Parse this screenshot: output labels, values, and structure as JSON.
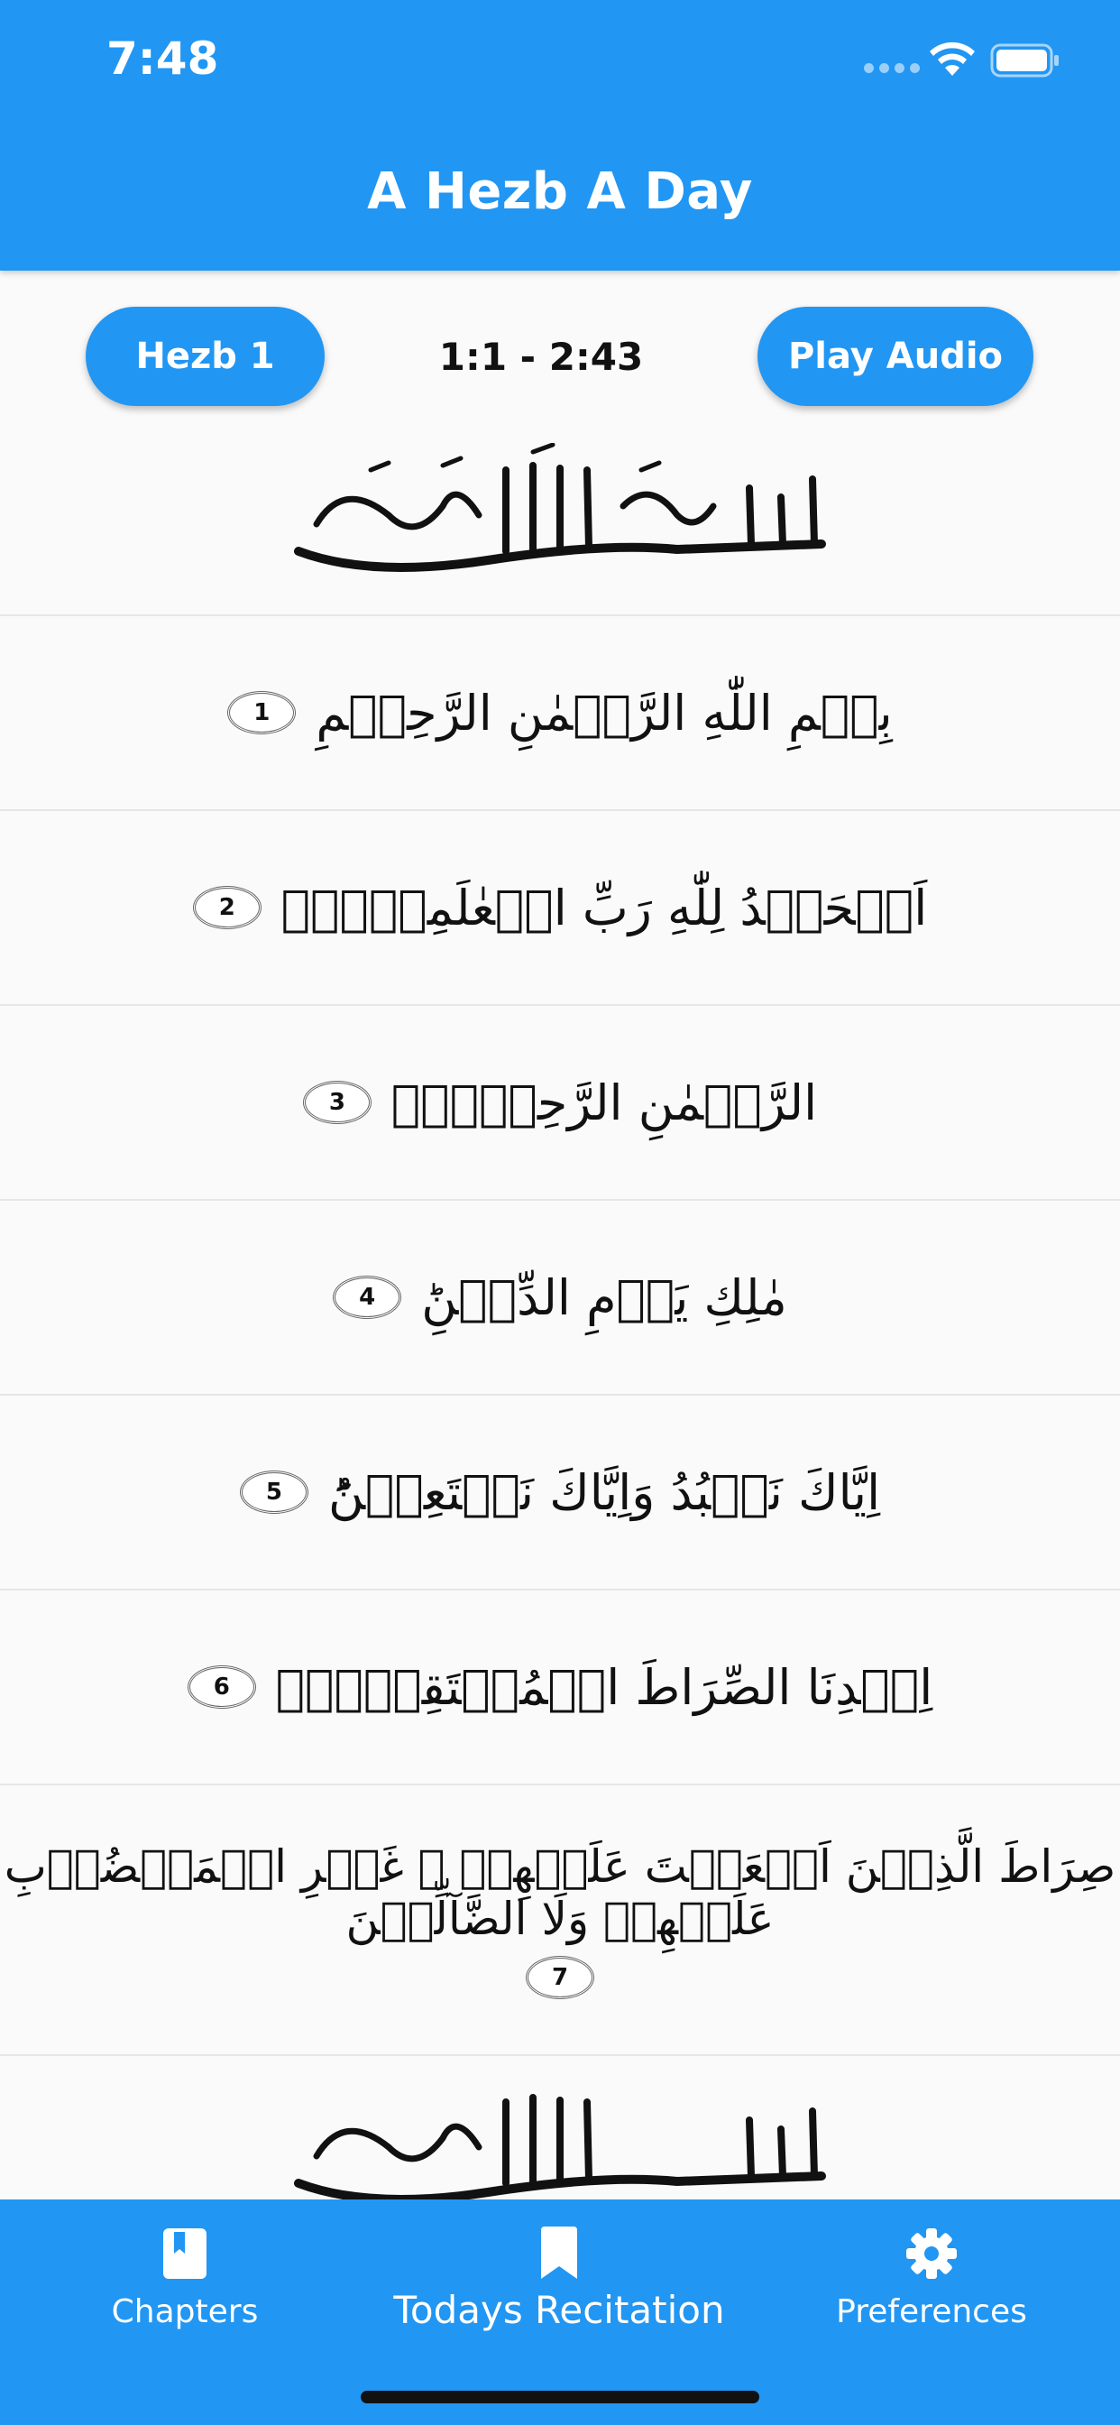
{
  "status_bar": {
    "time": "7:48"
  },
  "header": {
    "title": "A Hezb A Day"
  },
  "controls": {
    "hezb_label": "Hezb 1",
    "range": "1:1 - 2:43",
    "audio_label": "Play Audio"
  },
  "verses": [
    {
      "number": "1",
      "text": "بِسۡمِ اللّٰهِ الرَّحۡمٰنِ الرَّحِيۡمِ"
    },
    {
      "number": "2",
      "text": "اَلۡحَمۡدُ لِلّٰهِ رَبِّ الۡعٰلَمِيۡنَۙ"
    },
    {
      "number": "3",
      "text": "الرَّحۡمٰنِ الرَّحِيۡمِۙ"
    },
    {
      "number": "4",
      "text": "مٰلِكِ يَوۡمِ الدِّيۡنِؕ"
    },
    {
      "number": "5",
      "text": "اِيَّاكَ نَعۡبُدُ وَاِيَّاكَ نَسۡتَعِيۡنُؕ"
    },
    {
      "number": "6",
      "text": "اِهۡدِنَا الصِّرَاطَ الۡمُسۡتَقِيۡمَۙ"
    },
    {
      "number": "7",
      "text": "صِرَاطَ الَّذِيۡنَ اَنۡعَمۡتَ عَلَيۡهِمۡ  ۙ غَيۡرِ الۡمَغۡضُوۡبِ عَلَيۡهِمۡ وَلَا الضَّآلِّيۡنَ"
    }
  ],
  "bottom_nav": {
    "chapters": "Chapters",
    "today": "Todays Recitation",
    "preferences": "Preferences"
  },
  "icons": {
    "chapters": "book-icon",
    "today": "bookmark-icon",
    "preferences": "gear-icon",
    "wifi": "wifi-icon",
    "battery": "battery-icon"
  },
  "colors": {
    "primary": "#2196f3",
    "background": "#fafafa",
    "text": "#111111"
  }
}
